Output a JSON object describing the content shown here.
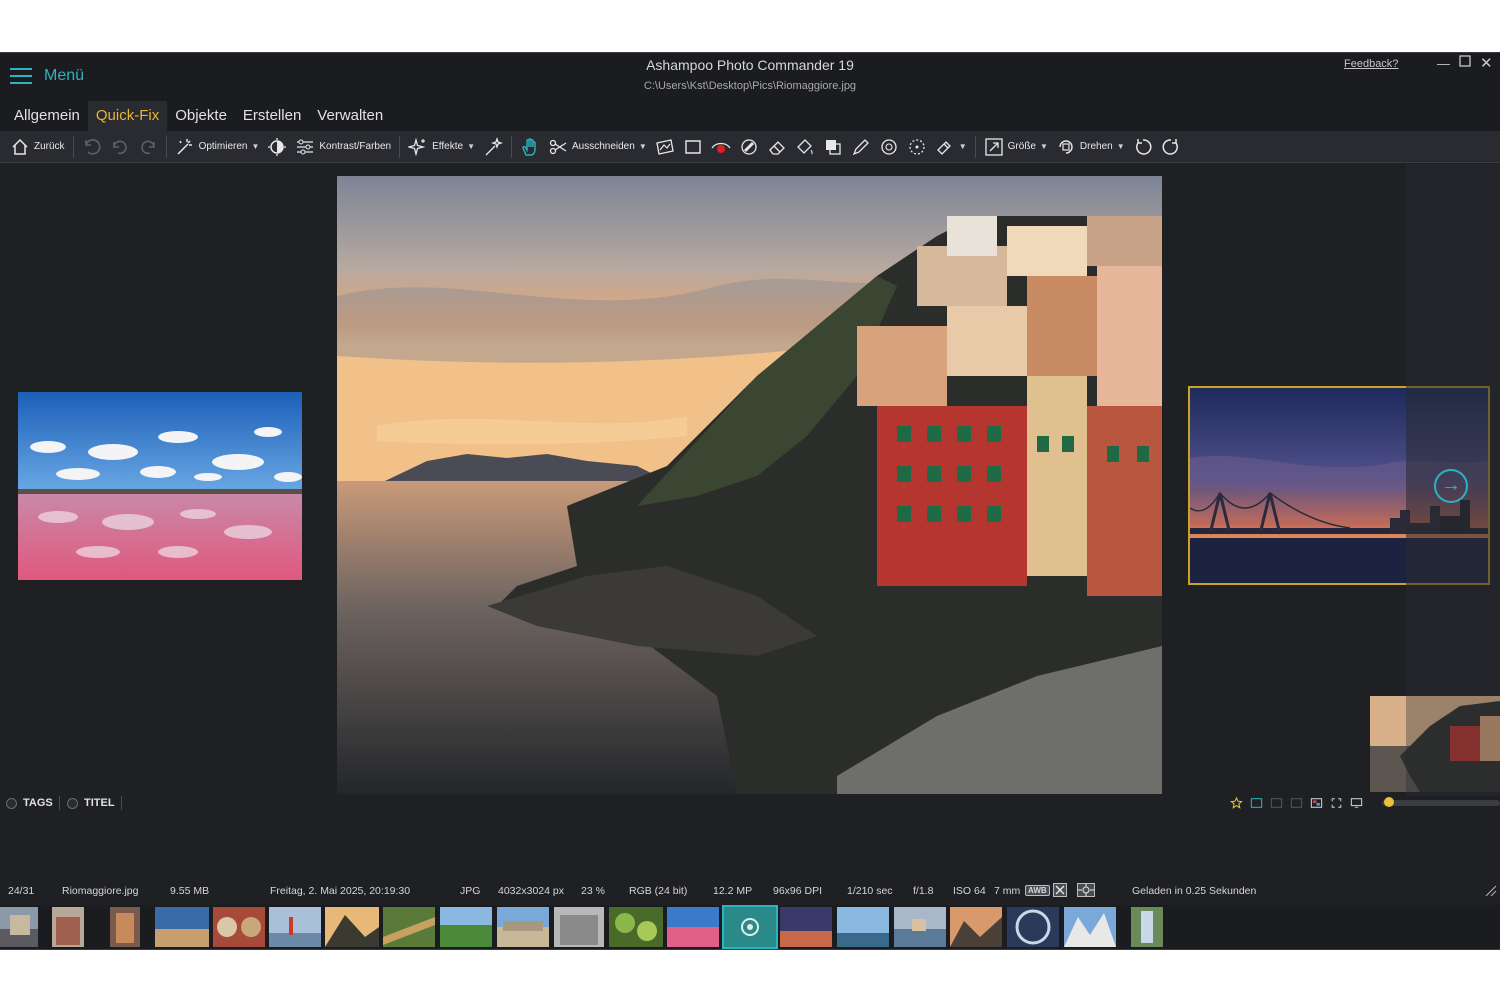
{
  "window": {
    "title": "Ashampoo Photo Commander 19",
    "path": "C:\\Users\\Kst\\Desktop\\Pics\\Riomaggiore.jpg",
    "feedback": "Feedback?"
  },
  "menu": {
    "label": "Menü"
  },
  "tabs": [
    {
      "label": "Allgemein",
      "active": false
    },
    {
      "label": "Quick-Fix",
      "active": true
    },
    {
      "label": "Objekte",
      "active": false
    },
    {
      "label": "Erstellen",
      "active": false
    },
    {
      "label": "Verwalten",
      "active": false
    }
  ],
  "toolbar": {
    "back": "Zurück",
    "optimize": "Optimieren",
    "contrast": "Kontrast/Farben",
    "effects": "Effekte",
    "crop": "Ausschneiden",
    "size": "Größe",
    "rotate": "Drehen"
  },
  "tags": {
    "tags_label": "TAGS",
    "title_label": "TITEL"
  },
  "status": {
    "index": "24/31",
    "filename": "Riomaggiore.jpg",
    "filesize": "9.55 MB",
    "date": "Freitag, 2. Mai 2025, 20:19:30",
    "format": "JPG",
    "dimensions": "4032x3024 px",
    "zoom": "23 %",
    "color": "RGB (24 bit)",
    "megapixels": "12.2 MP",
    "dpi": "96x96 DPI",
    "exposure": "1/210 sec",
    "aperture": "f/1.8",
    "iso": "ISO 64",
    "focal": "7 mm",
    "awb": "AWB",
    "loaded": "Geladen in 0.25 Sekunden"
  },
  "colors": {
    "accent": "#2bb3c0",
    "active_tab": "#e9b632",
    "selection": "#c9a227"
  }
}
